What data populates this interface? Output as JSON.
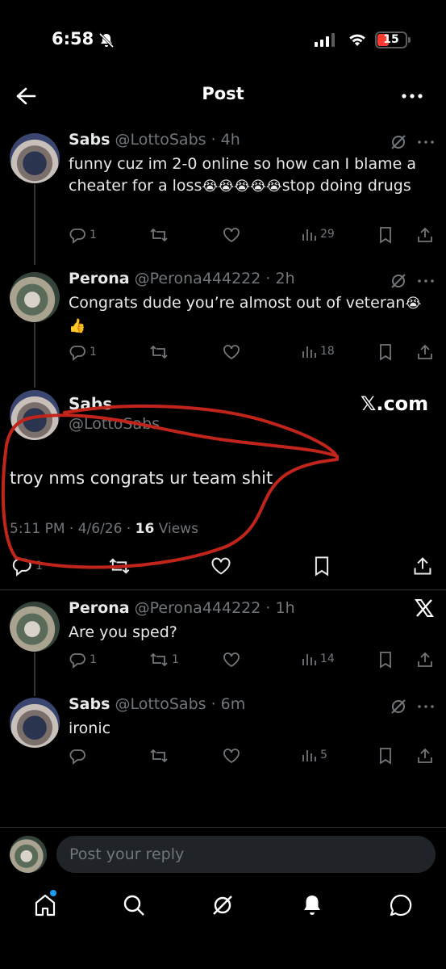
{
  "status_bar": {
    "time": "6:58",
    "battery": "15"
  },
  "header": {
    "title": "Post"
  },
  "thread": [
    {
      "name": "Sabs",
      "handle": "@LottoSabs",
      "time": "4h",
      "text": "funny cuz im 2-0 online so how can I blame a cheater for a loss",
      "text_suffix": "stop doing drugs",
      "emoji": "😭😭😭😭😭",
      "replies": "1",
      "views": "29"
    },
    {
      "name": "Perona",
      "handle": "@Perona444222",
      "time": "2h",
      "text": "Congrats dude you’re almost out of veteran",
      "emoji": "😭",
      "emoji2": "👍",
      "replies": "1",
      "views": "18"
    }
  ],
  "main_post": {
    "name": "Sabs",
    "handle": "@LottoSabs",
    "watermark": "𝕏.com",
    "text": "troy nms congrats ur team shit",
    "time": "5:11 PM",
    "date": "4/6/26",
    "views_count": "16",
    "views_label": "Views",
    "replies": "1"
  },
  "replies": [
    {
      "name": "Perona",
      "handle": "@Perona444222",
      "time": "1h",
      "text": "Are you sped?",
      "replies": "1",
      "reposts": "1",
      "views": "14"
    },
    {
      "name": "Sabs",
      "handle": "@LottoSabs",
      "time": "6m",
      "text": "ironic",
      "views": "5"
    }
  ],
  "reply_bar": {
    "placeholder": "Post your reply"
  },
  "colors": {
    "background": "#000000",
    "text": "#e7e9ea",
    "muted": "#71767b",
    "accent": "#1d9bf0",
    "annotation": "#c0241a"
  },
  "nav": [
    "home-icon",
    "search-icon",
    "grok-icon",
    "notifications-icon",
    "messages-icon"
  ]
}
